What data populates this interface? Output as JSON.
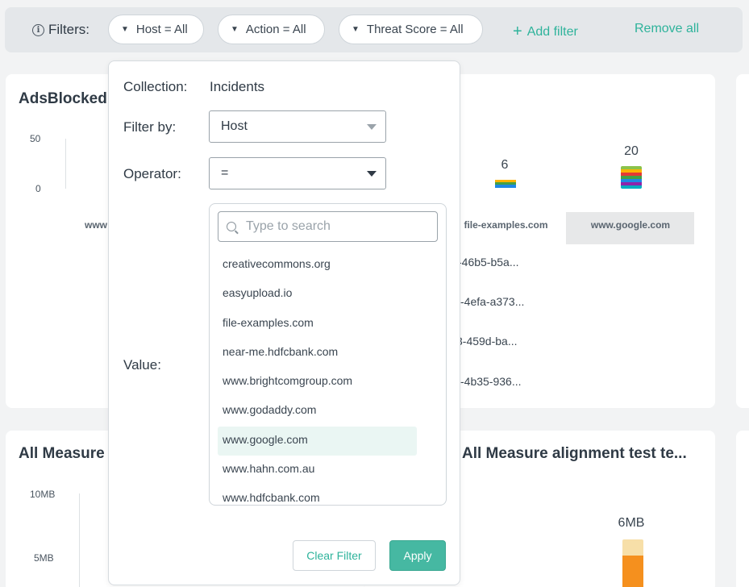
{
  "filter_bar": {
    "label": "Filters:",
    "chips": [
      {
        "label": "Host = All"
      },
      {
        "label": "Action = All"
      },
      {
        "label": "Threat Score = All"
      }
    ],
    "add_filter": "Add filter",
    "remove_all": "Remove all"
  },
  "cards": {
    "top_left": {
      "title": "AdsBlocked",
      "y_ticks": [
        "50",
        "0"
      ],
      "x_partial_label": "www"
    },
    "top_right": {
      "bars": [
        {
          "value": "6",
          "label": "file-examples.com"
        },
        {
          "value": "20",
          "label": "www.google.com"
        }
      ],
      "rows": [
        "-46b5-b5a...",
        "-4efa-a373...",
        "3-459d-ba...",
        "-4b35-936..."
      ]
    },
    "bottom_left": {
      "title": "All Measure",
      "y_ticks": [
        "10MB",
        "5MB"
      ]
    },
    "bottom_right": {
      "title": "All Measure alignment test te...",
      "bar_value": "6MB"
    }
  },
  "popover": {
    "collection_label": "Collection:",
    "collection_value": "Incidents",
    "filter_by_label": "Filter by:",
    "filter_by_value": "Host",
    "operator_label": "Operator:",
    "operator_value": "=",
    "value_label": "Value:",
    "search_placeholder": "Type to search",
    "options": [
      {
        "label": "creativecommons.org"
      },
      {
        "label": "easyupload.io"
      },
      {
        "label": "file-examples.com"
      },
      {
        "label": "near-me.hdfcbank.com"
      },
      {
        "label": "www.brightcomgroup.com"
      },
      {
        "label": "www.godaddy.com"
      },
      {
        "label": "www.google.com"
      },
      {
        "label": "www.hahn.com.au"
      },
      {
        "label": "www.hdfcbank.com"
      }
    ],
    "selected_option": "www.google.com",
    "clear_button": "Clear Filter",
    "apply_button": "Apply"
  },
  "colors": {
    "accent": "#2eb39b",
    "apply_bg": "#46b8a2",
    "selected_bg": "#eaf6f3",
    "stack_colors": [
      "#8bc34a",
      "#ffb300",
      "#e53935",
      "#43a047",
      "#1e88e5",
      "#8e24aa",
      "#00acc1"
    ],
    "orange_bar": "#f5901e",
    "orange_bar_light": "#f7dfa8"
  }
}
